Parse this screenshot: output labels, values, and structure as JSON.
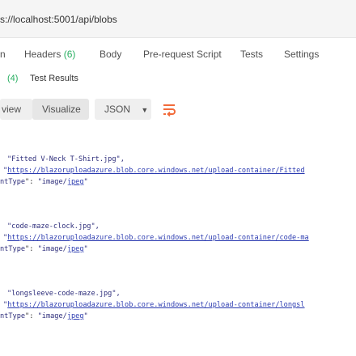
{
  "request": {
    "url": "s://localhost:5001/api/blobs",
    "tabs": [
      {
        "label": "n",
        "count": ""
      },
      {
        "label": "Headers",
        "count": "(6)"
      },
      {
        "label": "Body",
        "count": ""
      },
      {
        "label": "Pre-request Script",
        "count": ""
      },
      {
        "label": "Tests",
        "count": ""
      },
      {
        "label": "Settings",
        "count": ""
      }
    ]
  },
  "response": {
    "tabs": [
      {
        "label": "",
        "count": "(4)"
      },
      {
        "label": "Test Results",
        "count": ""
      }
    ],
    "toolbar": {
      "preview_label": "view",
      "visualize_label": "Visualize",
      "format_label": "JSON",
      "format_caret": "▼",
      "wrap_icon": "wrap-lines-icon"
    },
    "colors": {
      "accent": "#f26b3a",
      "count": "#27ae60"
    },
    "entries": [
      {
        "name": "\"Fitted V-Neck T-Shirt.jpg\",",
        "uri_quote": "\"",
        "uri": "https://blazoruploadazure.blob.core.windows.net/upload-container/Fitted",
        "ct_key": "ntType",
        "ct_sep": "\": ",
        "ct_quote_open": "\"",
        "ct_value_pre": "image/",
        "ct_value_link": "jpeg",
        "ct_quote_close": "\""
      },
      {
        "name": "\"code-maze-clock.jpg\",",
        "uri_quote": "\"",
        "uri": "https://blazoruploadazure.blob.core.windows.net/upload-container/code-ma",
        "ct_key": "ntType",
        "ct_sep": "\": ",
        "ct_quote_open": "\"",
        "ct_value_pre": "image/",
        "ct_value_link": "jpeg",
        "ct_quote_close": "\""
      },
      {
        "name": "\"longsleeve-code-maze.jpg\",",
        "uri_quote": "\"",
        "uri": "https://blazoruploadazure.blob.core.windows.net/upload-container/longsl",
        "ct_key": "ntType",
        "ct_sep": "\": ",
        "ct_quote_open": "\"",
        "ct_value_pre": "image/",
        "ct_value_link": "jpeg",
        "ct_quote_close": "\""
      }
    ]
  }
}
